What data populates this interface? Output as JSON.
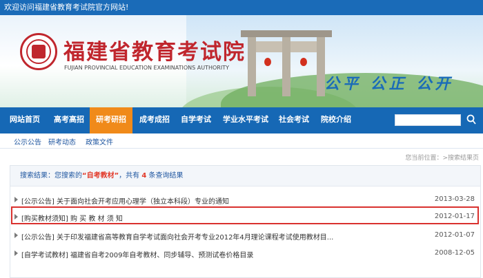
{
  "topbar": {
    "welcome": "欢迎访问福建省教育考试院官方网站!"
  },
  "header": {
    "title": "福建省教育考试院",
    "subtitle": "FUJIAN PROVINCIAL EDUCATION EXAMINATIONS AUTHORITY",
    "slogan": "公平 公正 公开"
  },
  "nav": {
    "items": [
      "网站首页",
      "高考高招",
      "研考研招",
      "成考成招",
      "自学考试",
      "学业水平考试",
      "社会考试",
      "院校介绍"
    ],
    "active_index": 2
  },
  "subnav": {
    "items": [
      "公示公告",
      "研考动态",
      "政策文件"
    ]
  },
  "breadcrumb": "您当前位置：>搜索结果页",
  "results": {
    "prefix": "搜索结果：您搜索的",
    "keyword": "“自考教材”",
    "mid": "，共有",
    "count": "4",
    "suffix": "条查询结果",
    "items": [
      {
        "title": "[公示公告] 关于面向社会开考应用心理学（独立本科段）专业的通知",
        "date": "2013-03-28"
      },
      {
        "title": "[购买教材须知] 购 买 教 材 须 知",
        "date": "2012-01-17"
      },
      {
        "title": "[公示公告] 关于印发福建省高等教育自学考试面向社会开考专业2012年4月理论课程考试使用教材目...",
        "date": "2012-01-07"
      },
      {
        "title": "[自学考试教材] 福建省自考2009年自考教材、同步辅导、预测试卷价格目录",
        "date": "2008-12-05"
      }
    ]
  },
  "colors": {
    "nav": "#1668b5",
    "active": "#f08a1a",
    "brand_red": "#c0262d",
    "highlight": "#d9302d"
  }
}
